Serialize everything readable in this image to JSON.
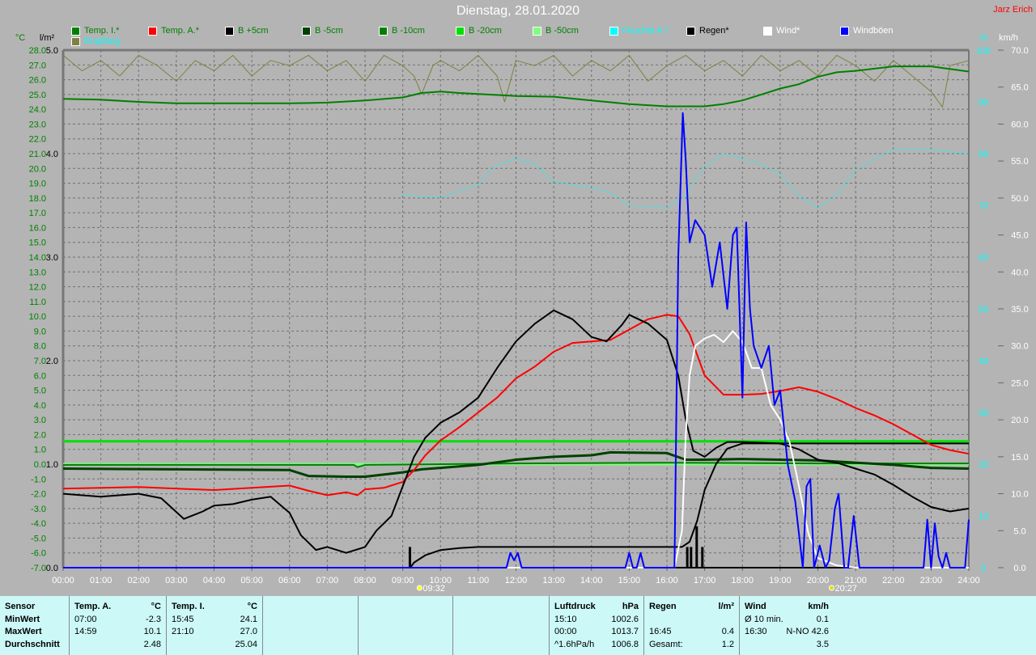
{
  "header": {
    "title": "Dienstag, 28.01.2020",
    "author": "Jarz Erich"
  },
  "legend": [
    {
      "label": "Temp. I.*",
      "color": "#008000",
      "text_color": "#008000"
    },
    {
      "label": "Temp. A.*",
      "color": "#ff0000",
      "text_color": "#008000"
    },
    {
      "label": "B +5cm",
      "color": "#000000",
      "text_color": "#008000"
    },
    {
      "label": "B -5cm",
      "color": "#004000",
      "text_color": "#008000"
    },
    {
      "label": "B -10cm",
      "color": "#008000",
      "text_color": "#008000"
    },
    {
      "label": "B -20cm",
      "color": "#00e000",
      "text_color": "#008000"
    },
    {
      "label": "B -50cm",
      "color": "#80ff80",
      "text_color": "#008000"
    },
    {
      "label": "Feuchte A.*",
      "color": "#00ffff",
      "text_color": "#00ffff"
    },
    {
      "label": "Regen*",
      "color": "#000000",
      "text_color": "#000000"
    },
    {
      "label": "Wind*",
      "color": "#ffffff",
      "text_color": "#ffffff"
    },
    {
      "label": "Windböen",
      "color": "#0000ff",
      "text_color": "#ffffff"
    },
    {
      "label": "Empfang",
      "color": "#808040",
      "text_color": "#00ffff"
    }
  ],
  "chart_data": {
    "type": "line",
    "title": "Dienstag, 28.01.2020",
    "x_unit": "hours",
    "xlim": [
      0,
      24
    ],
    "x_ticks": [
      "00:00",
      "01:00",
      "02:00",
      "03:00",
      "04:00",
      "05:00",
      "06:00",
      "07:00",
      "08:00",
      "09:00",
      "10:00",
      "11:00",
      "12:00",
      "13:00",
      "14:00",
      "15:00",
      "16:00",
      "17:00",
      "18:00",
      "19:00",
      "20:00",
      "21:00",
      "22:00",
      "23:00",
      "24:00"
    ],
    "axes": {
      "temp": {
        "label": "°C",
        "ylim": [
          -7,
          28
        ],
        "step": 1
      },
      "rain": {
        "label": "l/m²",
        "ylim": [
          0,
          5
        ],
        "step": 1
      },
      "humidity": {
        "label": "%",
        "ylim": [
          0,
          100
        ],
        "step": 10
      },
      "wind": {
        "label": "km/h",
        "ylim": [
          0,
          70
        ],
        "step": 5
      }
    },
    "markers": [
      {
        "label": "09:32",
        "x": 9.53,
        "type": "sunrise"
      },
      {
        "label": "20:27",
        "x": 20.45,
        "type": "sunset"
      }
    ],
    "series": [
      {
        "name": "Temp. I.*",
        "axis": "temp",
        "color": "#008000",
        "width": 2,
        "x": [
          0,
          1,
          2,
          3,
          4,
          5,
          6,
          7,
          8,
          9,
          9.5,
          10,
          10.5,
          12,
          13,
          14,
          15,
          16,
          16.5,
          17,
          17.5,
          18,
          18.5,
          19,
          19.5,
          20,
          20.5,
          21,
          22,
          23,
          24
        ],
        "y": [
          24.7,
          24.65,
          24.5,
          24.4,
          24.4,
          24.4,
          24.4,
          24.45,
          24.6,
          24.8,
          25.1,
          25.2,
          25.1,
          24.9,
          24.85,
          24.6,
          24.35,
          24.2,
          24.2,
          24.2,
          24.35,
          24.6,
          25.0,
          25.4,
          25.7,
          26.2,
          26.5,
          26.6,
          26.9,
          26.9,
          26.55
        ]
      },
      {
        "name": "B -50cm",
        "axis": "temp",
        "color": "#80ff80",
        "width": 3,
        "x": [
          0,
          24
        ],
        "y": [
          0,
          0
        ]
      },
      {
        "name": "B -20cm",
        "axis": "temp",
        "color": "#00e000",
        "width": 3,
        "x": [
          0,
          24
        ],
        "y": [
          1.55,
          1.55
        ]
      },
      {
        "name": "B -10cm",
        "axis": "temp",
        "color": "#008000",
        "width": 2,
        "x": [
          0,
          7.7,
          7.8,
          8,
          12,
          16,
          20,
          24
        ],
        "y": [
          -0.05,
          -0.05,
          -0.2,
          -0.05,
          0.05,
          0.1,
          0.05,
          0.05
        ]
      },
      {
        "name": "B -5cm",
        "axis": "temp",
        "color": "#004000",
        "width": 3,
        "x": [
          0,
          3,
          6,
          6.5,
          7.5,
          8,
          9,
          9.5,
          10,
          11,
          12,
          13,
          14,
          14.5,
          16,
          16.5,
          17,
          18,
          20,
          22,
          23,
          24
        ],
        "y": [
          -0.3,
          -0.35,
          -0.4,
          -0.8,
          -0.85,
          -0.85,
          -0.55,
          -0.35,
          -0.25,
          -0.05,
          0.3,
          0.5,
          0.6,
          0.8,
          0.75,
          0.3,
          0.3,
          0.35,
          0.25,
          -0.05,
          -0.25,
          -0.3
        ]
      },
      {
        "name": "Temp. A.*",
        "axis": "temp",
        "color": "#ff0000",
        "width": 2,
        "x": [
          0,
          1,
          2,
          3,
          4,
          5,
          6,
          6.5,
          7,
          7.5,
          7.8,
          8,
          8.5,
          9,
          9.3,
          9.6,
          10,
          10.5,
          11,
          11.5,
          12,
          12.5,
          13,
          13.5,
          14,
          14.5,
          15,
          15.5,
          16,
          16.3,
          16.6,
          17,
          17.5,
          18,
          18.5,
          19,
          19.5,
          20,
          20.5,
          21,
          21.5,
          22,
          22.5,
          23,
          23.5,
          24
        ],
        "y": [
          -1.65,
          -1.6,
          -1.55,
          -1.65,
          -1.75,
          -1.6,
          -1.45,
          -1.8,
          -2.1,
          -1.9,
          -2.1,
          -1.7,
          -1.6,
          -1.2,
          -0.4,
          0.6,
          1.6,
          2.5,
          3.5,
          4.5,
          5.8,
          6.6,
          7.6,
          8.2,
          8.3,
          8.4,
          9.1,
          9.8,
          10.1,
          10.0,
          8.8,
          6.0,
          4.7,
          4.7,
          4.75,
          4.95,
          5.2,
          4.9,
          4.4,
          3.8,
          3.3,
          2.7,
          2.0,
          1.3,
          0.95,
          0.7
        ]
      },
      {
        "name": "B +5cm",
        "axis": "temp",
        "color": "#000000",
        "width": 2,
        "x": [
          0,
          1,
          2,
          2.6,
          3.2,
          3.7,
          4,
          4.5,
          5,
          5.5,
          6,
          6.3,
          6.7,
          7,
          7.5,
          8,
          8.3,
          8.7,
          9,
          9.3,
          9.6,
          10,
          10.5,
          11,
          11.5,
          12,
          12.5,
          13,
          13.5,
          14,
          14.4,
          14.8,
          15,
          15.5,
          16,
          16.3,
          16.5,
          16.7,
          17,
          17.3,
          17.6,
          18,
          19,
          19.5,
          20,
          20.5,
          21,
          21.5,
          22,
          22.5,
          23,
          23.5,
          24
        ],
        "y": [
          -2.0,
          -2.2,
          -2.0,
          -2.3,
          -3.7,
          -3.2,
          -2.8,
          -2.7,
          -2.4,
          -2.2,
          -3.3,
          -4.8,
          -5.8,
          -5.6,
          -6.0,
          -5.6,
          -4.5,
          -3.5,
          -1.5,
          0.5,
          1.8,
          2.8,
          3.5,
          4.5,
          6.5,
          8.3,
          9.5,
          10.4,
          9.8,
          8.6,
          8.3,
          9.4,
          10.1,
          9.5,
          8.4,
          6.0,
          3.0,
          0.9,
          0.5,
          1.1,
          1.5,
          1.5,
          1.4,
          1.0,
          0.3,
          0.1,
          -0.3,
          -0.7,
          -1.4,
          -2.2,
          -2.9,
          -3.2,
          -3.0
        ]
      },
      {
        "name": "Feuchte A.*",
        "axis": "humidity",
        "color": "#00ffff",
        "width": 1,
        "dashed": true,
        "x": [
          9,
          10,
          11,
          11.4,
          12,
          12.5,
          13,
          14,
          14.5,
          15,
          16,
          16.4,
          17,
          17.5,
          18,
          18.5,
          19,
          19.5,
          20,
          20.5,
          21,
          22,
          23,
          24
        ],
        "y": [
          72,
          71.5,
          74,
          77.5,
          79,
          78,
          74.5,
          73.4,
          72.5,
          70,
          69.5,
          71.5,
          77.5,
          80,
          79,
          78,
          76,
          72,
          69.5,
          72,
          77,
          80.8,
          80.8,
          80
        ]
      },
      {
        "name": "Empfang",
        "axis": "humidity",
        "color": "#808040",
        "width": 1,
        "x": [
          0,
          0.5,
          1,
          1.5,
          2,
          2.5,
          3,
          3.5,
          4,
          4.5,
          5,
          5.5,
          6,
          6.5,
          7,
          7.5,
          8,
          8.5,
          9,
          9.3,
          9.5,
          9.8,
          10,
          10.5,
          11,
          11.5,
          11.7,
          12,
          12.5,
          13,
          13.5,
          14,
          14.5,
          15,
          15.5,
          16,
          16.5,
          17,
          17.5,
          18,
          18.5,
          19,
          19.5,
          20,
          20.5,
          21,
          21.5,
          22,
          22.5,
          23,
          23.3,
          23.5,
          24
        ],
        "y": [
          99,
          96,
          98,
          95,
          99,
          97,
          94,
          98,
          96,
          99,
          95,
          98,
          97,
          99,
          96,
          98,
          94,
          99,
          97,
          95,
          91.5,
          97,
          98,
          96,
          99,
          95,
          90,
          98,
          97,
          99,
          95,
          98,
          96,
          99,
          94,
          97,
          99,
          96,
          98,
          95,
          99,
          96,
          98,
          95,
          99,
          97,
          94,
          98,
          95,
          92,
          89,
          97,
          98
        ]
      },
      {
        "name": "Wind*",
        "axis": "wind",
        "color": "#ffffff",
        "width": 2,
        "x": [
          0,
          16.2,
          16.4,
          16.5,
          16.6,
          16.75,
          17,
          17.25,
          17.5,
          17.75,
          18,
          18.25,
          18.5,
          18.75,
          19,
          19.25,
          19.5,
          19.75,
          20,
          20.5,
          21,
          24
        ],
        "y": [
          0,
          0,
          5,
          18,
          26,
          30,
          31,
          31.5,
          30.5,
          32,
          30.5,
          27,
          27,
          22,
          20,
          17,
          11,
          4.6,
          1.3,
          0.3,
          0,
          0
        ]
      },
      {
        "name": "Windböen",
        "axis": "wind",
        "color": "#0000ff",
        "width": 2,
        "x": [
          0,
          11.75,
          11.85,
          11.95,
          12.05,
          12.15,
          14.9,
          15.0,
          15.1,
          15.2,
          15.3,
          15.4,
          16.2,
          16.3,
          16.42,
          16.5,
          16.6,
          16.75,
          17,
          17.2,
          17.4,
          17.6,
          17.75,
          17.85,
          18,
          18.1,
          18.2,
          18.3,
          18.5,
          18.7,
          18.85,
          19,
          19.2,
          19.4,
          19.6,
          19.7,
          19.8,
          19.9,
          20.05,
          20.2,
          20.3,
          20.45,
          20.55,
          20.7,
          20.8,
          20.95,
          21.1,
          22.8,
          22.9,
          23.0,
          23.1,
          23.2,
          23.3,
          23.4,
          23.5,
          23.9,
          24
        ],
        "y": [
          0,
          0,
          2,
          1,
          2,
          0,
          0,
          2,
          0,
          0,
          2,
          0,
          0,
          42,
          61.5,
          55,
          44,
          47,
          45,
          38,
          44,
          35,
          45,
          46,
          23,
          46.7,
          35,
          30,
          27,
          30,
          22,
          24,
          14,
          9,
          0,
          11,
          12,
          0,
          3,
          0,
          1,
          8,
          10,
          0,
          0,
          7,
          0,
          0,
          6.5,
          0,
          6,
          1.5,
          0,
          2,
          0,
          0,
          6.5
        ]
      },
      {
        "name": "Regen* (Summe)",
        "axis": "rain",
        "color": "#000000",
        "width": 2,
        "x": [
          0,
          9.2,
          9.3,
          9.6,
          10,
          10.5,
          11,
          16.4,
          16.6,
          16.8,
          17,
          17.3,
          17.6,
          18,
          24
        ],
        "y": [
          0,
          0,
          0.05,
          0.12,
          0.17,
          0.19,
          0.2,
          0.2,
          0.25,
          0.45,
          0.75,
          1.0,
          1.15,
          1.2,
          1.2
        ]
      }
    ],
    "rain_bars": {
      "name": "Regen* (Intervall)",
      "axis": "rain",
      "color": "#000000",
      "x": [
        9.2,
        16.55,
        16.65,
        16.8,
        16.95
      ],
      "y": [
        0.2,
        0.2,
        0.2,
        0.4,
        0.2
      ]
    }
  },
  "table": {
    "sensor": {
      "title": "Sensor",
      "rows": [
        "MinWert",
        "MaxWert",
        "Durchschnitt"
      ]
    },
    "temp_a": {
      "title": "Temp. A.",
      "unit": "°C",
      "min_time": "07:00",
      "min": "-2.3",
      "max_time": "14:59",
      "max": "10.1",
      "avg": "2.48"
    },
    "temp_i": {
      "title": "Temp. I.",
      "unit": "°C",
      "min_time": "15:45",
      "min": "24.1",
      "max_time": "21:10",
      "max": "27.0",
      "avg": "25.04"
    },
    "pressure": {
      "title": "Luftdruck",
      "unit": "hPa",
      "min_time": "15:10",
      "min": "1002.6",
      "max_time": "00:00",
      "max": "1013.7",
      "trend": "^1.6hPa/h",
      "avg": "1006.8"
    },
    "rain": {
      "title": "Regen",
      "unit": "l/m²",
      "max_time": "16:45",
      "max": "0.4",
      "total_label": "Gesamt:",
      "total": "1.2"
    },
    "wind": {
      "title": "Wind",
      "unit": "km/h",
      "avg10_label": "Ø 10 min.",
      "avg10": "0.1",
      "max_time": "16:30",
      "max": "N-NO 42.6",
      "avg": "3.5"
    }
  }
}
